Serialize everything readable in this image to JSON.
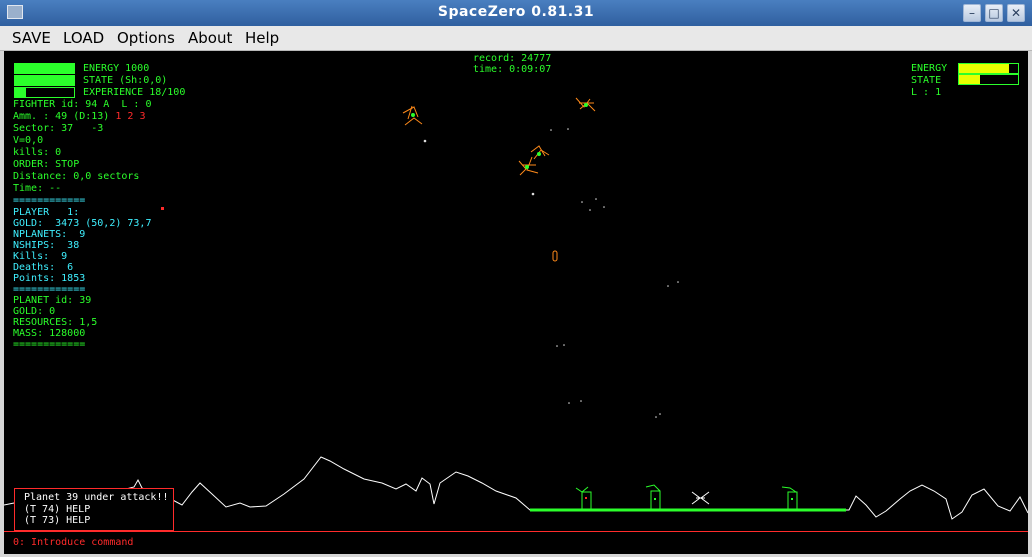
{
  "window": {
    "title": "SpaceZero  0.81.31"
  },
  "menu": [
    "SAVE",
    "LOAD",
    "Options",
    "About",
    "Help"
  ],
  "record": {
    "record_line": "record: 24777",
    "time_line": "time: 0:09:07"
  },
  "ship_status": {
    "energy_label": "ENERGY 1000",
    "energy_fraction": 1.0,
    "state_label": "STATE (Sh:0,0)",
    "state_fraction": 1.0,
    "experience_label": "EXPERIENCE 18/100",
    "experience_fraction": 0.18,
    "fighter": "FIGHTER id: 94 A  L : 0",
    "ammo_prefix": "Amm. : 49 (D:13)",
    "ammo_weapons": "1 2 3",
    "sector": "Sector: 37   -3",
    "velocity": "V=0,0",
    "kills": "kills: 0",
    "order": "ORDER: STOP",
    "distance": "Distance: 0,0 sectors",
    "time": "Time: --"
  },
  "separator": "============",
  "player": {
    "player": "PLAYER   1:",
    "gold": "GOLD:  3473 (50,2) 73,7",
    "nplanets": "NPLANETS:  9",
    "nships": "NSHIPS:  38",
    "kills": "Kills:  9",
    "deaths": "Deaths:  6",
    "points": "Points: 1853"
  },
  "planet": {
    "planet": "PLANET id: 39",
    "gold": "GOLD: 0",
    "resources": "RESOURCES: 1,5",
    "mass": "MASS: 128000"
  },
  "target_status": {
    "energy_label": "ENERGY",
    "energy_fraction": 0.85,
    "state_label": "STATE",
    "state_fraction": 0.35,
    "level": "L : 1"
  },
  "messages": [
    "Planet 39 under attack!!",
    "(T 74) HELP",
    "(T 73) HELP"
  ],
  "command_prompt": "0: Introduce command",
  "colors": {
    "hud_green": "#2bff2b",
    "hud_cyan": "#3ff0ff",
    "alert_red": "#ff2b2b",
    "bar_yellow": "#e8ff00"
  }
}
